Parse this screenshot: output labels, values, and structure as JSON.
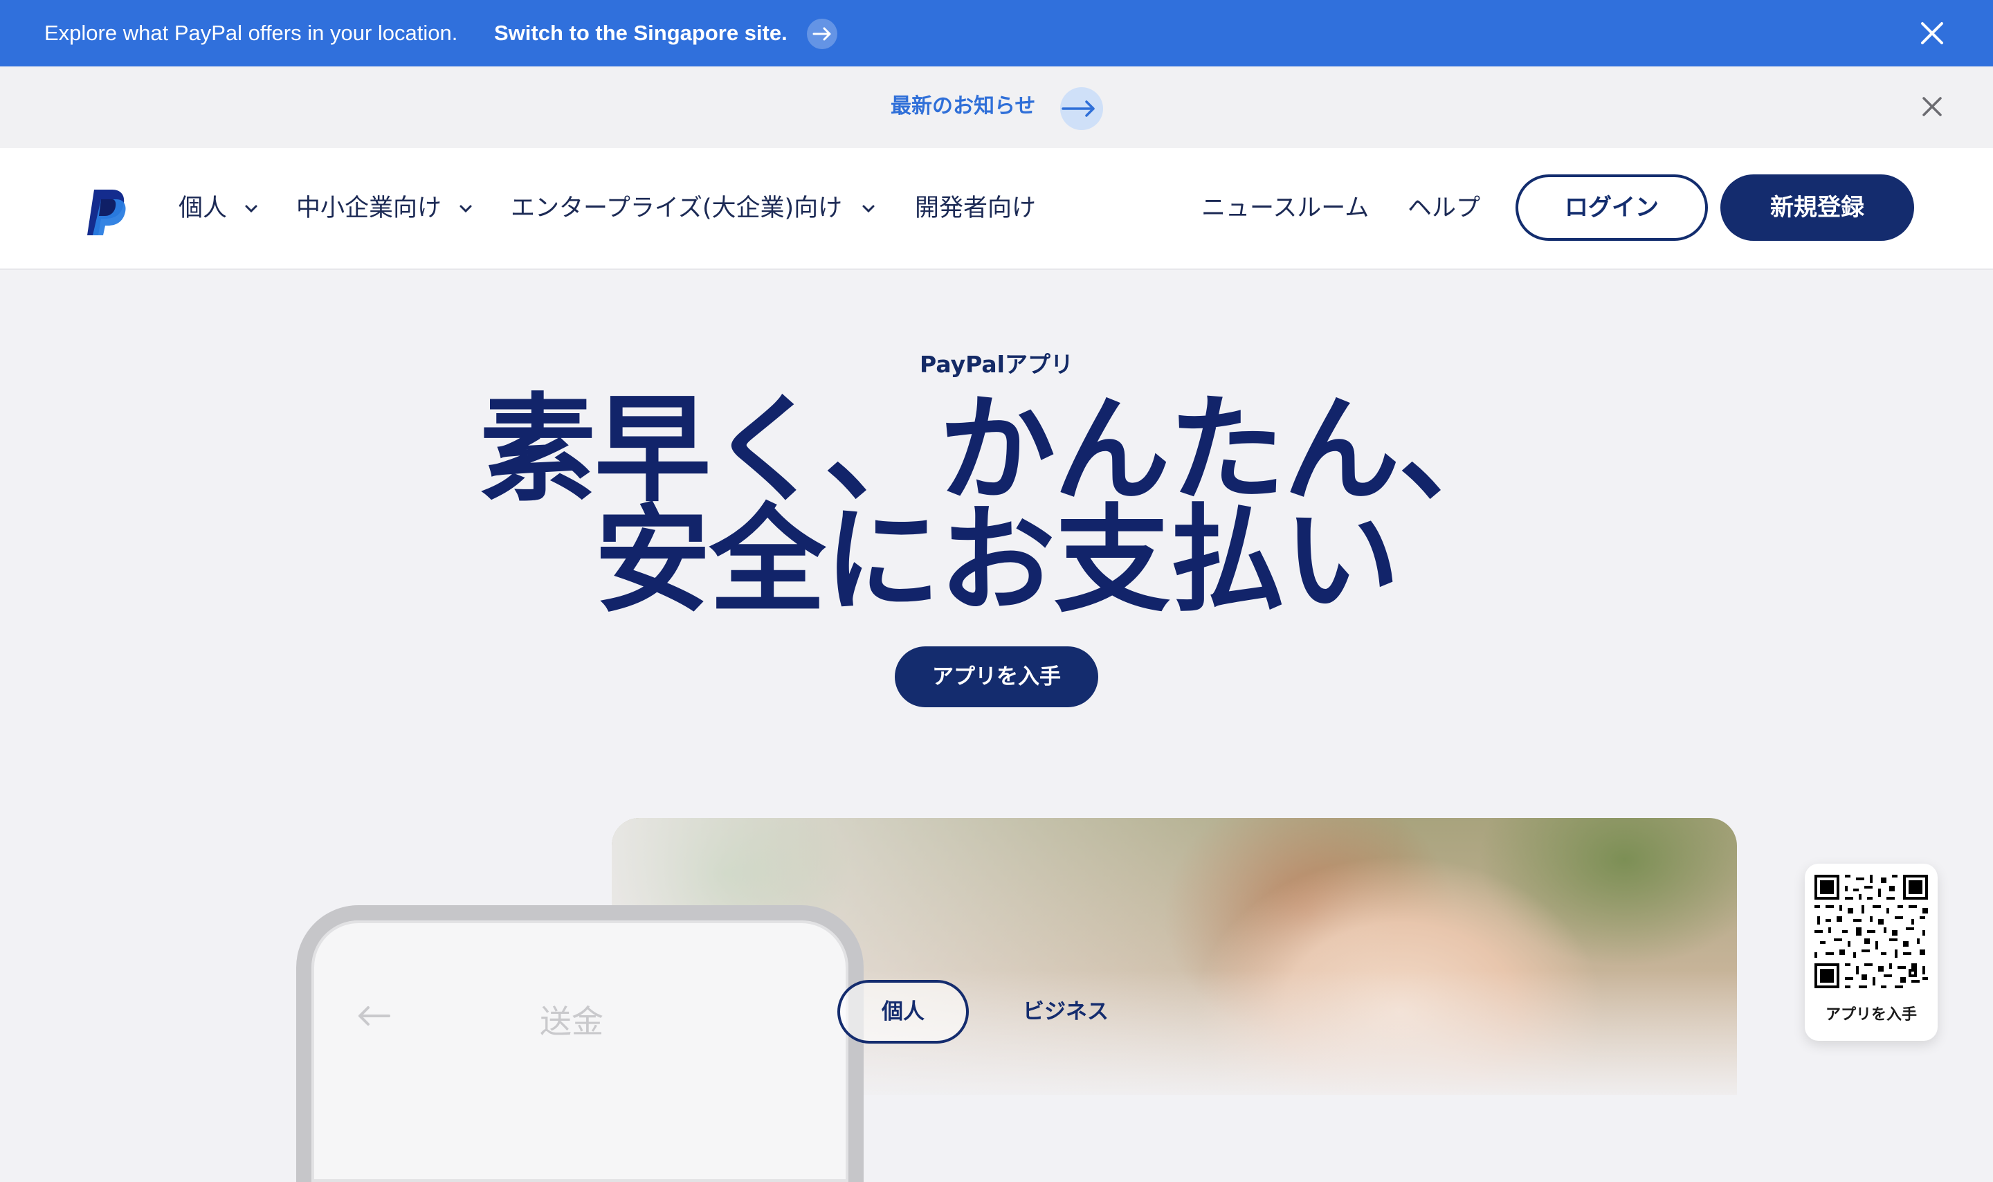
{
  "geo_banner": {
    "text": "Explore what PayPal offers in your location.",
    "link": "Switch to the Singapore site."
  },
  "announcement": {
    "link": "最新のお知らせ"
  },
  "nav": {
    "items": [
      {
        "label": "個人"
      },
      {
        "label": "中小企業向け"
      },
      {
        "label": "エンタープライズ(大企業)向け"
      },
      {
        "label": "開発者向け"
      }
    ],
    "newsroom": "ニュースルーム",
    "help": "ヘルプ",
    "login": "ログイン",
    "signup": "新規登録"
  },
  "hero": {
    "eyebrow": "PayPalアプリ",
    "title_line1": "素早く、かんたん、",
    "title_line2": "安全にお支払い",
    "cta": "アプリを入手"
  },
  "phone": {
    "title": "送金"
  },
  "segments": {
    "personal": "個人",
    "business": "ビジネス"
  },
  "qr_card": {
    "label": "アプリを入手"
  },
  "colors": {
    "banner_blue": "#3070dc",
    "brand_navy": "#142c6e",
    "link_blue": "#2f6fd8"
  }
}
